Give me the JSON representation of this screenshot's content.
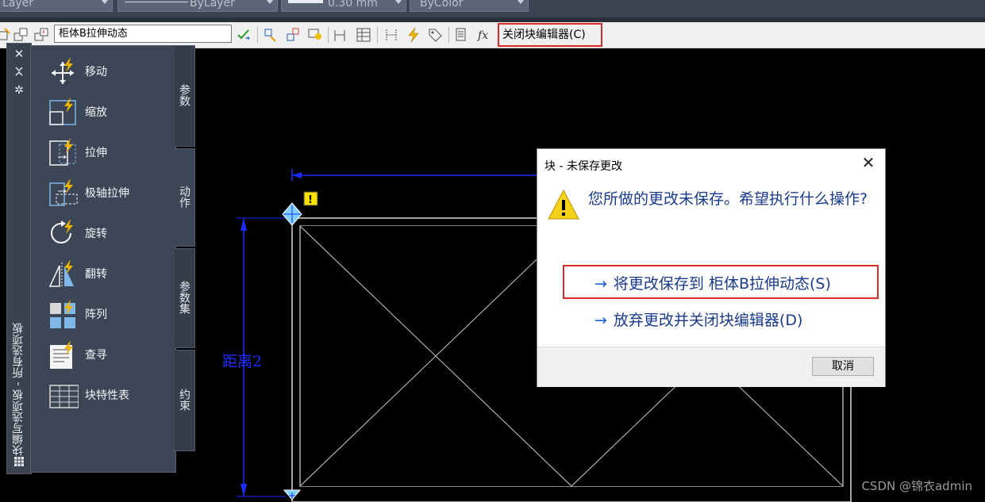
{
  "properties_bar": {
    "layer": "Layer",
    "linetype": "ByLayer",
    "lineweight": "0.30 mm",
    "color": "ByColor"
  },
  "toolbar": {
    "block_name": "柜体B拉伸动态",
    "close_block_editor": "关闭块编辑器(C)"
  },
  "palette": {
    "title": "块编写选项板 - 所有选项板",
    "tabs": [
      "参数",
      "动作",
      "参数集",
      "约束"
    ],
    "tools": [
      "移动",
      "缩放",
      "拉伸",
      "极轴拉伸",
      "旋转",
      "翻转",
      "阵列",
      "查寻",
      "块特性表"
    ]
  },
  "drawing": {
    "dimension_label": "距离2"
  },
  "dialog": {
    "title": "块 - 未保存更改",
    "message": "您所做的更改未保存。希望执行什么操作?",
    "option_save": "将更改保存到 柜体B拉伸动态(S)",
    "option_discard": "放弃更改并关闭块编辑器(D)",
    "cancel": "取消"
  },
  "watermark": "CSDN @锦衣admin",
  "colors": {
    "dialog_text": "#1a3a8c",
    "highlight_border": "#d92a2a",
    "dimension": "#1a2cff"
  }
}
